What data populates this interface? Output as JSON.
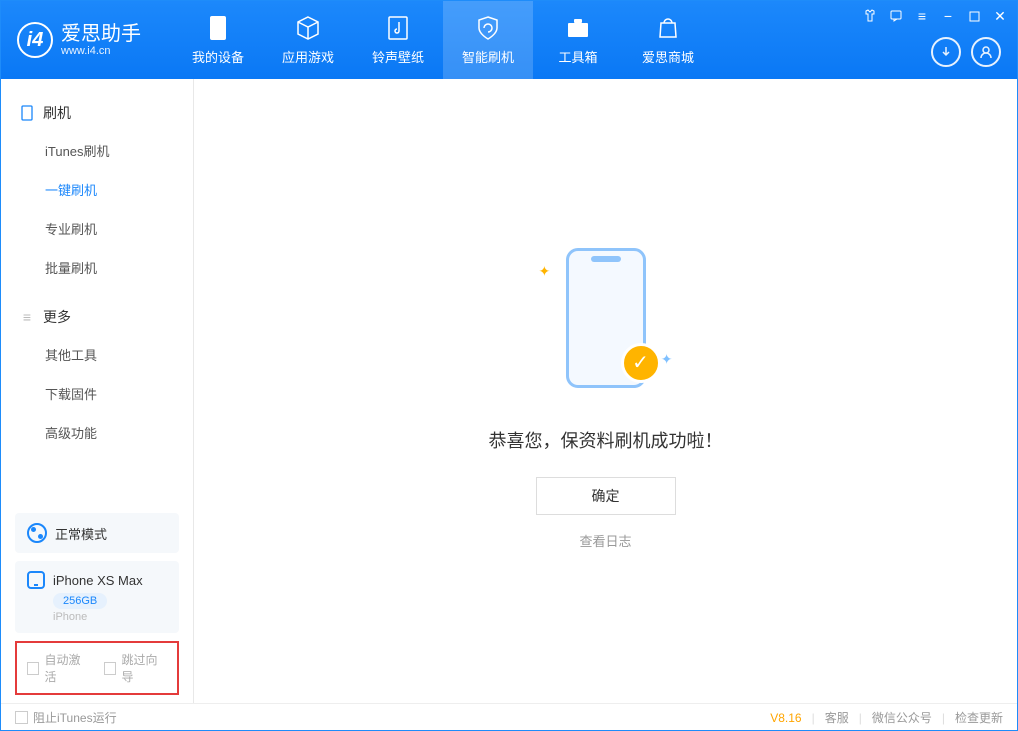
{
  "app": {
    "title": "爱思助手",
    "subtitle": "www.i4.cn"
  },
  "nav": {
    "tabs": [
      {
        "label": "我的设备"
      },
      {
        "label": "应用游戏"
      },
      {
        "label": "铃声壁纸"
      },
      {
        "label": "智能刷机"
      },
      {
        "label": "工具箱"
      },
      {
        "label": "爱思商城"
      }
    ]
  },
  "sidebar": {
    "group1": {
      "title": "刷机",
      "items": [
        "iTunes刷机",
        "一键刷机",
        "专业刷机",
        "批量刷机"
      ]
    },
    "group2": {
      "title": "更多",
      "items": [
        "其他工具",
        "下载固件",
        "高级功能"
      ]
    },
    "mode": {
      "label": "正常模式"
    },
    "device": {
      "name": "iPhone XS Max",
      "capacity": "256GB",
      "type": "iPhone"
    },
    "checks": {
      "auto_activate": "自动激活",
      "skip_guide": "跳过向导"
    }
  },
  "main": {
    "success_text": "恭喜您，保资料刷机成功啦！",
    "ok_button": "确定",
    "view_log": "查看日志"
  },
  "footer": {
    "block_itunes": "阻止iTunes运行",
    "version": "V8.16",
    "service": "客服",
    "wechat": "微信公众号",
    "update": "检查更新"
  }
}
